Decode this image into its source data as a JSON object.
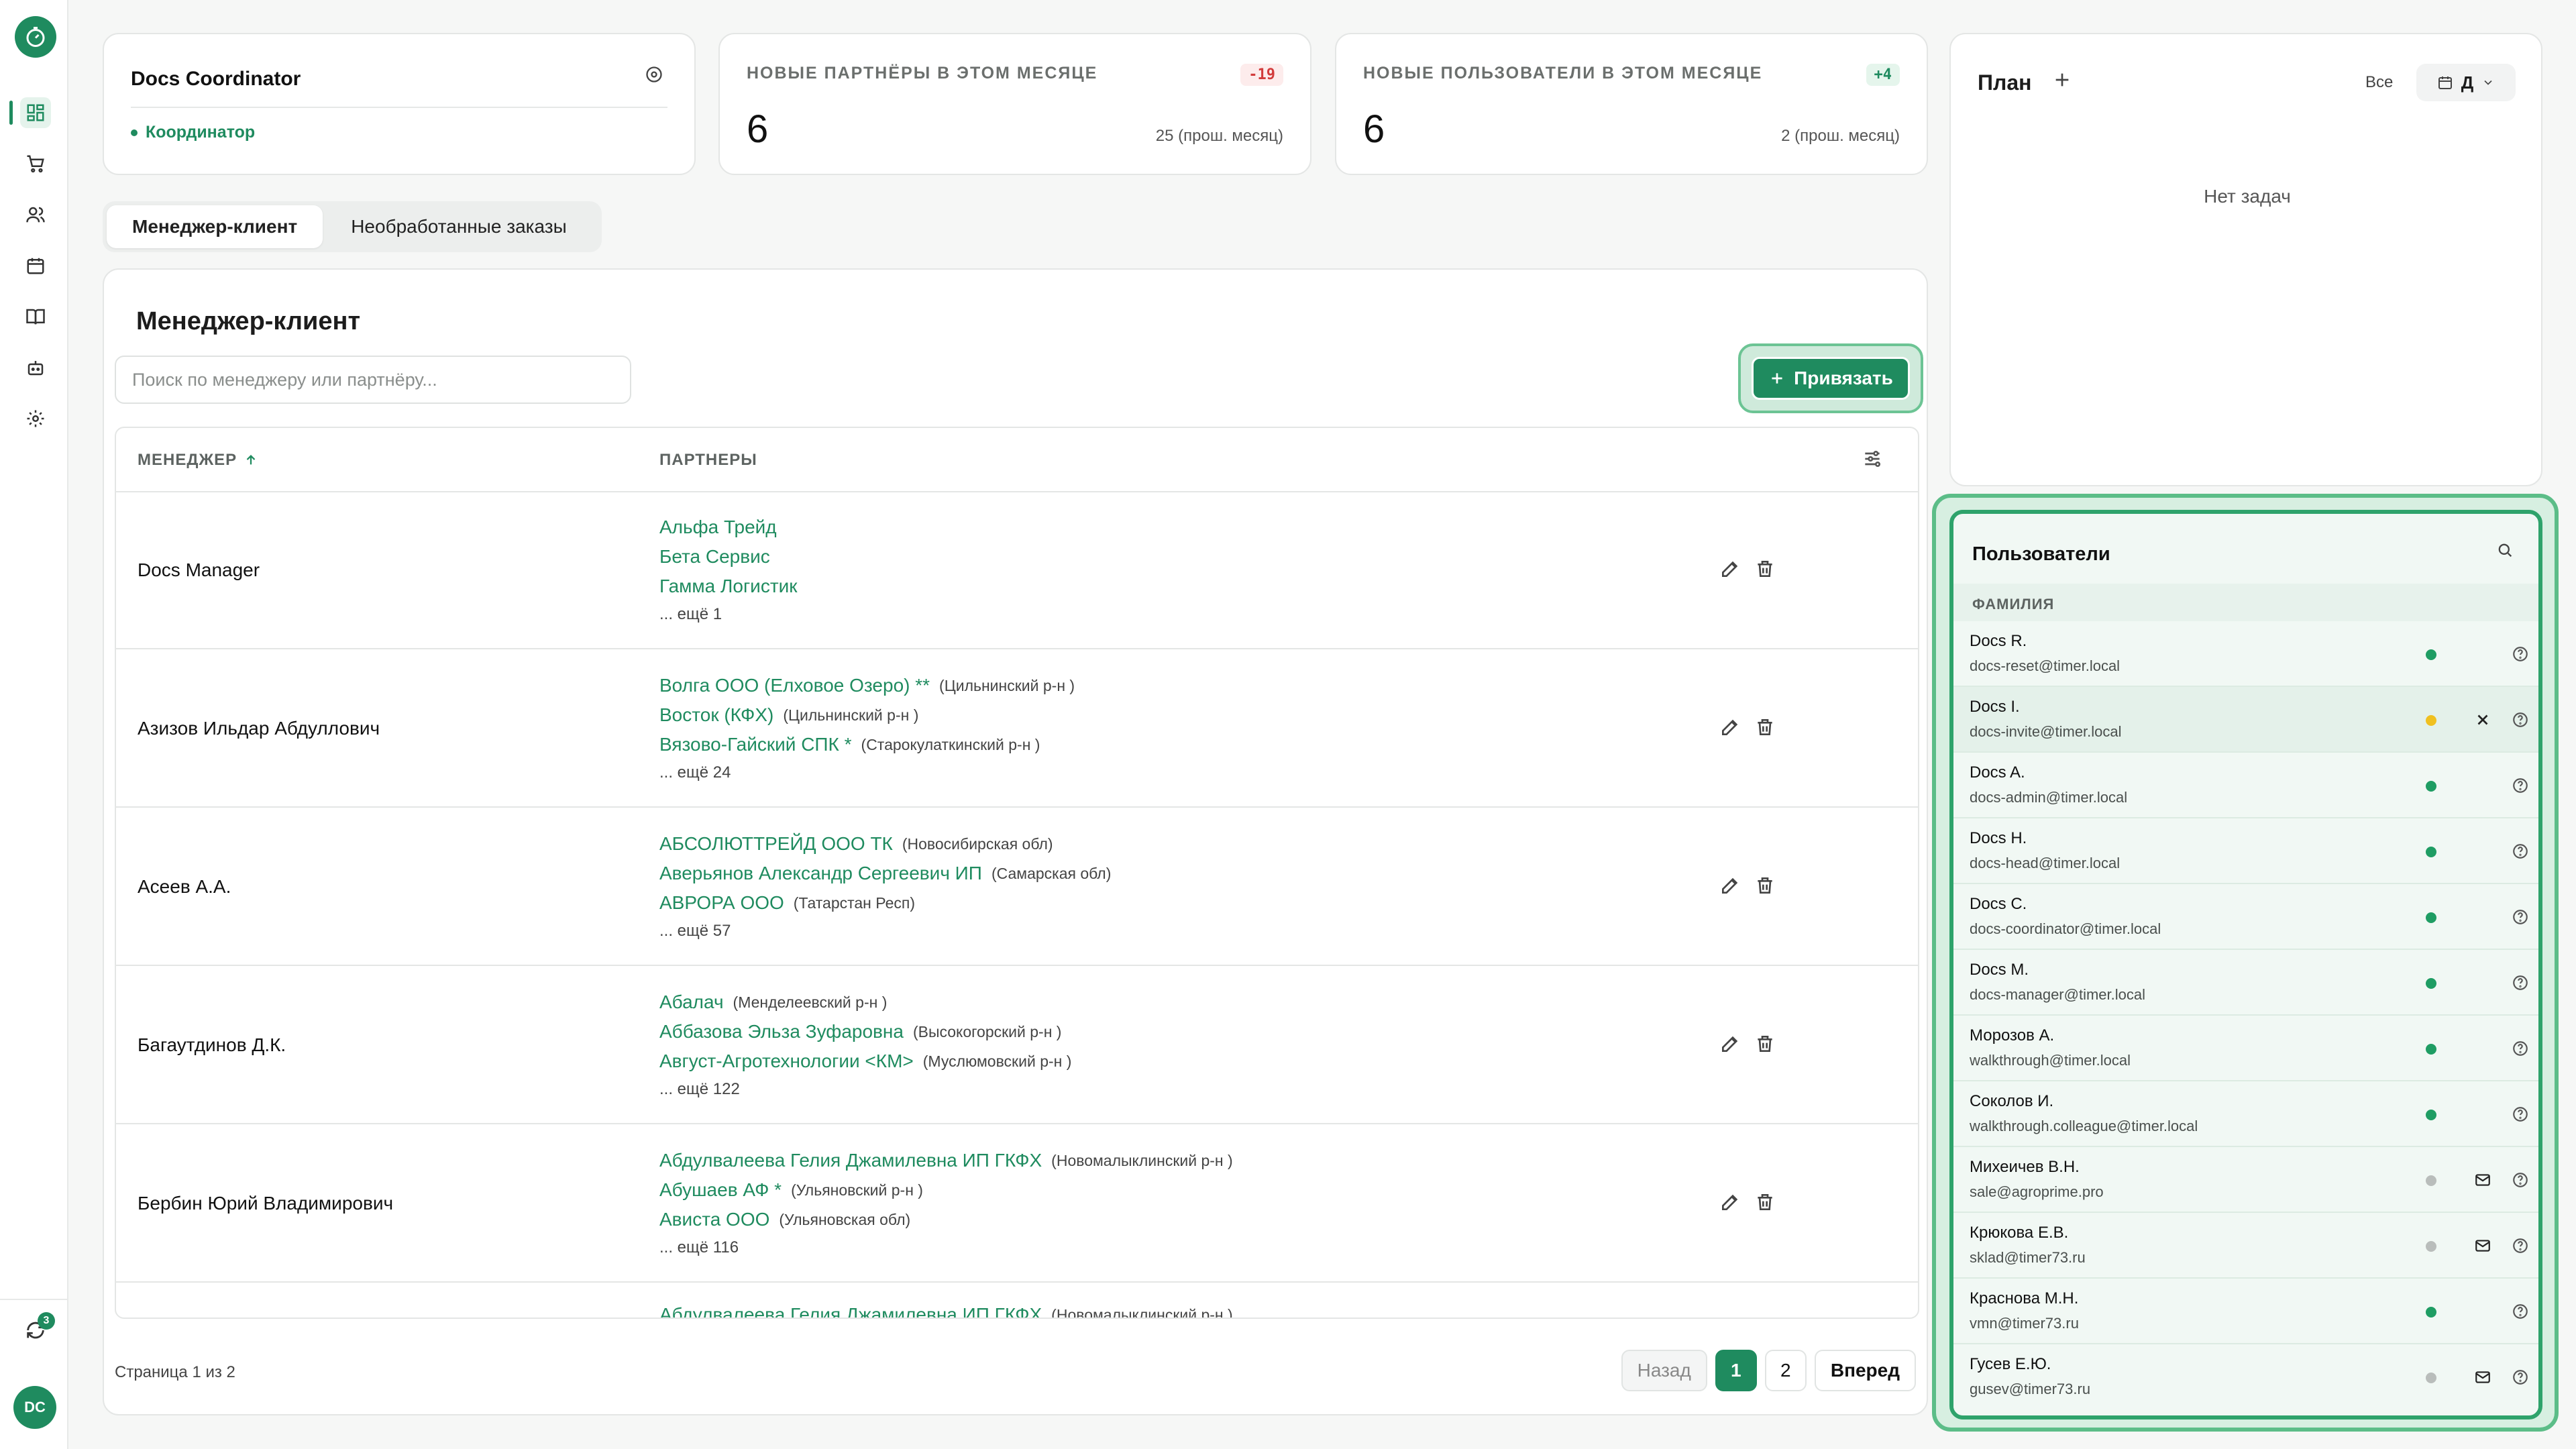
{
  "colors": {
    "accent": "#1f8b5f",
    "online": "#1f9d63",
    "away": "#f0c020",
    "offline": "#b9bdbb"
  },
  "sidebar": {
    "items": [
      {
        "icon": "dashboard-icon",
        "active": true
      },
      {
        "icon": "cart-icon"
      },
      {
        "icon": "users-icon"
      },
      {
        "icon": "calendar-icon"
      },
      {
        "icon": "book-icon"
      },
      {
        "icon": "robot-icon"
      },
      {
        "icon": "gear-icon"
      }
    ],
    "sync_badge": "3",
    "avatar": "DC"
  },
  "coordinator": {
    "title": "Docs Coordinator",
    "role": "Координатор"
  },
  "stats": [
    {
      "label": "НОВЫЕ ПАРТНЁРЫ В ЭТОМ МЕСЯЦЕ",
      "badge": "-19",
      "value": "6",
      "prev": "25 (прош. месяц)"
    },
    {
      "label": "НОВЫЕ ПОЛЬЗОВАТЕЛИ В ЭТОМ МЕСЯЦЕ",
      "badge": "+4",
      "value": "6",
      "prev": "2 (прош. месяц)"
    }
  ],
  "plan": {
    "title": "План",
    "filter": "Все",
    "view": "Д",
    "empty": "Нет задач"
  },
  "tabs": [
    {
      "label": "Менеджер-клиент",
      "active": true
    },
    {
      "label": "Необработанные заказы"
    }
  ],
  "main": {
    "title": "Менеджер-клиент",
    "search_placeholder": "Поиск по менеджеру или партнёру...",
    "bind_button": "Привязать",
    "col_manager": "МЕНЕДЖЕР",
    "col_partners": "ПАРТНЕРЫ",
    "rows": [
      {
        "manager": "Docs Manager",
        "partners": [
          {
            "name": "Альфа Трейд",
            "region": ""
          },
          {
            "name": "Бета Сервис",
            "region": ""
          },
          {
            "name": "Гамма Логистик",
            "region": ""
          }
        ],
        "more": "... ещё 1"
      },
      {
        "manager": "Азизов Ильдар Абдуллович",
        "partners": [
          {
            "name": "Волга ООО (Елховое Озеро) **",
            "region": "(Цильнинский р-н )"
          },
          {
            "name": "Восток (КФХ)",
            "region": "(Цильнинский р-н )"
          },
          {
            "name": "Вязово-Гайский СПК *",
            "region": "(Старокулаткинский р-н )"
          }
        ],
        "more": "... ещё 24"
      },
      {
        "manager": "Асеев А.А.",
        "partners": [
          {
            "name": "АБСОЛЮТТРЕЙД ООО ТК",
            "region": "(Новосибирская обл)"
          },
          {
            "name": "Аверьянов Александр Сергеевич ИП",
            "region": "(Самарская обл)"
          },
          {
            "name": "АВРОРА ООО",
            "region": "(Татарстан Респ)"
          }
        ],
        "more": "... ещё 57"
      },
      {
        "manager": "Багаутдинов Д.К.",
        "partners": [
          {
            "name": "Абалач",
            "region": "(Менделеевский р-н )"
          },
          {
            "name": "Аббазова Эльза Зуфаровна",
            "region": "(Высокогорский р-н )"
          },
          {
            "name": "Август-Агротехнологии <КМ>",
            "region": "(Муслюмовский р-н )"
          }
        ],
        "more": "... ещё 122"
      },
      {
        "manager": "Бербин Юрий Владимирович",
        "partners": [
          {
            "name": "Абдулвалеева Гелия Джамилевна ИП ГКФХ",
            "region": "(Новомалыклинский р-н )"
          },
          {
            "name": "Абушаев АФ *",
            "region": "(Ульяновский р-н )"
          },
          {
            "name": "Ависта ООО",
            "region": "(Ульяновская обл)"
          }
        ],
        "more": "... ещё 116"
      },
      {
        "manager": "",
        "partners": [
          {
            "name": "Абдулвалеева Гелия Джамилевна ИП ГКФХ",
            "region": "(Новомалыклинский р-н )"
          }
        ],
        "more": ""
      }
    ],
    "pager_text": "Страница 1 из 2",
    "prev": "Назад",
    "pages": [
      "1",
      "2"
    ],
    "next": "Вперед"
  },
  "users": {
    "title": "Пользователи",
    "col": "ФАМИЛИЯ",
    "list": [
      {
        "name": "Docs R.",
        "email": "docs-reset@timer.local",
        "status": "online",
        "action": ""
      },
      {
        "name": "Docs I.",
        "email": "docs-invite@timer.local",
        "status": "away",
        "action": "close"
      },
      {
        "name": "Docs A.",
        "email": "docs-admin@timer.local",
        "status": "online",
        "action": ""
      },
      {
        "name": "Docs H.",
        "email": "docs-head@timer.local",
        "status": "online",
        "action": ""
      },
      {
        "name": "Docs C.",
        "email": "docs-coordinator@timer.local",
        "status": "online",
        "action": ""
      },
      {
        "name": "Docs M.",
        "email": "docs-manager@timer.local",
        "status": "online",
        "action": ""
      },
      {
        "name": "Морозов А.",
        "email": "walkthrough@timer.local",
        "status": "online",
        "action": ""
      },
      {
        "name": "Соколов И.",
        "email": "walkthrough.colleague@timer.local",
        "status": "online",
        "action": ""
      },
      {
        "name": "Михеичев В.Н.",
        "email": "sale@agroprime.pro",
        "status": "offline",
        "action": "mail"
      },
      {
        "name": "Крюкова Е.В.",
        "email": "sklad@timer73.ru",
        "status": "offline",
        "action": "mail"
      },
      {
        "name": "Краснова М.Н.",
        "email": "vmn@timer73.ru",
        "status": "online",
        "action": ""
      },
      {
        "name": "Гусев Е.Ю.",
        "email": "gusev@timer73.ru",
        "status": "offline",
        "action": "mail"
      }
    ]
  }
}
